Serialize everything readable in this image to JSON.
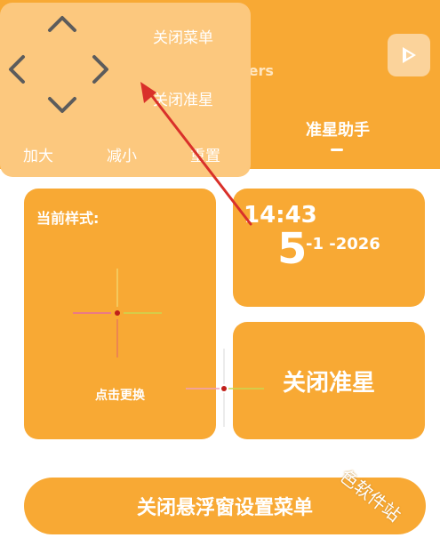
{
  "background": {
    "subtitle_fragment": "ters",
    "tab_title": "准星助手"
  },
  "style_card": {
    "label": "当前样式:",
    "tap_label": "点击更换"
  },
  "time_card": {
    "time": "14:43",
    "day": "5",
    "month_year": "-1 -2026"
  },
  "close_star_card": {
    "label": "关闭准星"
  },
  "close_settings_button": {
    "label": "关闭悬浮窗设置菜单"
  },
  "floating_panel": {
    "close_menu": "关闭菜单",
    "close_star": "关闭准星",
    "enlarge": "加大",
    "shrink": "减小",
    "reset": "重置"
  },
  "watermark": "色软件站",
  "colors": {
    "accent": "#f8a934",
    "panel": "#fcc87e",
    "arrow": "#d9302a"
  },
  "icons": {
    "play": "play-icon",
    "up": "chevron-up-icon",
    "down": "chevron-down-icon",
    "left": "chevron-left-icon",
    "right": "chevron-right-icon",
    "crosshair": "crosshair-icon"
  }
}
